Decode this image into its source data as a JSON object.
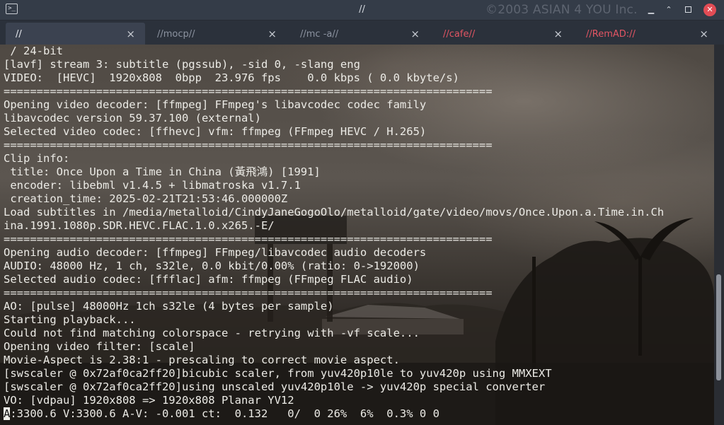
{
  "window": {
    "app_icon": "terminal-icon",
    "title": "//",
    "watermark": "©2003 ASIAN 4 YOU Inc.",
    "buttons": [
      "shade-icon",
      "minimize-icon",
      "maximize-icon",
      "close-icon"
    ]
  },
  "tabs": [
    {
      "label": "//",
      "state": "active"
    },
    {
      "label": "//mocp//",
      "state": "inactive"
    },
    {
      "label": "//mc -a//",
      "state": "inactive"
    },
    {
      "label": "//cafe//",
      "state": "alert"
    },
    {
      "label": "//RemAD://",
      "state": "alert"
    }
  ],
  "tab_close_glyph": "×",
  "colors": {
    "alert_tab_text": "#e25563",
    "terminal_text": "#ecebe6",
    "close_button": "#e24c55"
  },
  "terminal": {
    "lines": [
      " / 24-bit",
      "[lavf] stream 3: subtitle (pgssub), -sid 0, -slang eng",
      "VIDEO:  [HEVC]  1920x808  0bpp  23.976 fps    0.0 kbps ( 0.0 kbyte/s)",
      "==========================================================================",
      "Opening video decoder: [ffmpeg] FFmpeg's libavcodec codec family",
      "libavcodec version 59.37.100 (external)",
      "Selected video codec: [ffhevc] vfm: ffmpeg (FFmpeg HEVC / H.265)",
      "==========================================================================",
      "Clip info:",
      " title: Once Upon a Time in China (黃飛鴻) [1991]",
      " encoder: libebml v1.4.5 + libmatroska v1.7.1",
      " creation_time: 2025-02-21T21:53:46.000000Z",
      "Load subtitles in /media/metalloid/CindyJaneGogoOlo/metalloid/gate/video/movs/Once.Upon.a.Time.in.Ch",
      "ina.1991.1080p.SDR.HEVC.FLAC.1.0.x265.-E/",
      "==========================================================================",
      "Opening audio decoder: [ffmpeg] FFmpeg/libavcodec audio decoders",
      "AUDIO: 48000 Hz, 1 ch, s32le, 0.0 kbit/0.00% (ratio: 0->192000)",
      "Selected audio codec: [ffflac] afm: ffmpeg (FFmpeg FLAC audio)",
      "==========================================================================",
      "AO: [pulse] 48000Hz 1ch s32le (4 bytes per sample)",
      "Starting playback...",
      "Could not find matching colorspace - retrying with -vf scale...",
      "Opening video filter: [scale]",
      "Movie-Aspect is 2.38:1 - prescaling to correct movie aspect.",
      "[swscaler @ 0x72af0ca2ff20]bicubic scaler, from yuv420p10le to yuv420p using MMXEXT",
      "[swscaler @ 0x72af0ca2ff20]using unscaled yuv420p10le -> yuv420p special converter",
      "VO: [vdpau] 1920x808 => 1920x808 Planar YV12"
    ],
    "status_cursor_char": "A",
    "status_rest": ":3300.6 V:3300.6 A-V: -0.001 ct:  0.132   0/  0 26%  6%  0.3% 0 0"
  },
  "scrollbar": {
    "position_fraction": 0.85
  }
}
